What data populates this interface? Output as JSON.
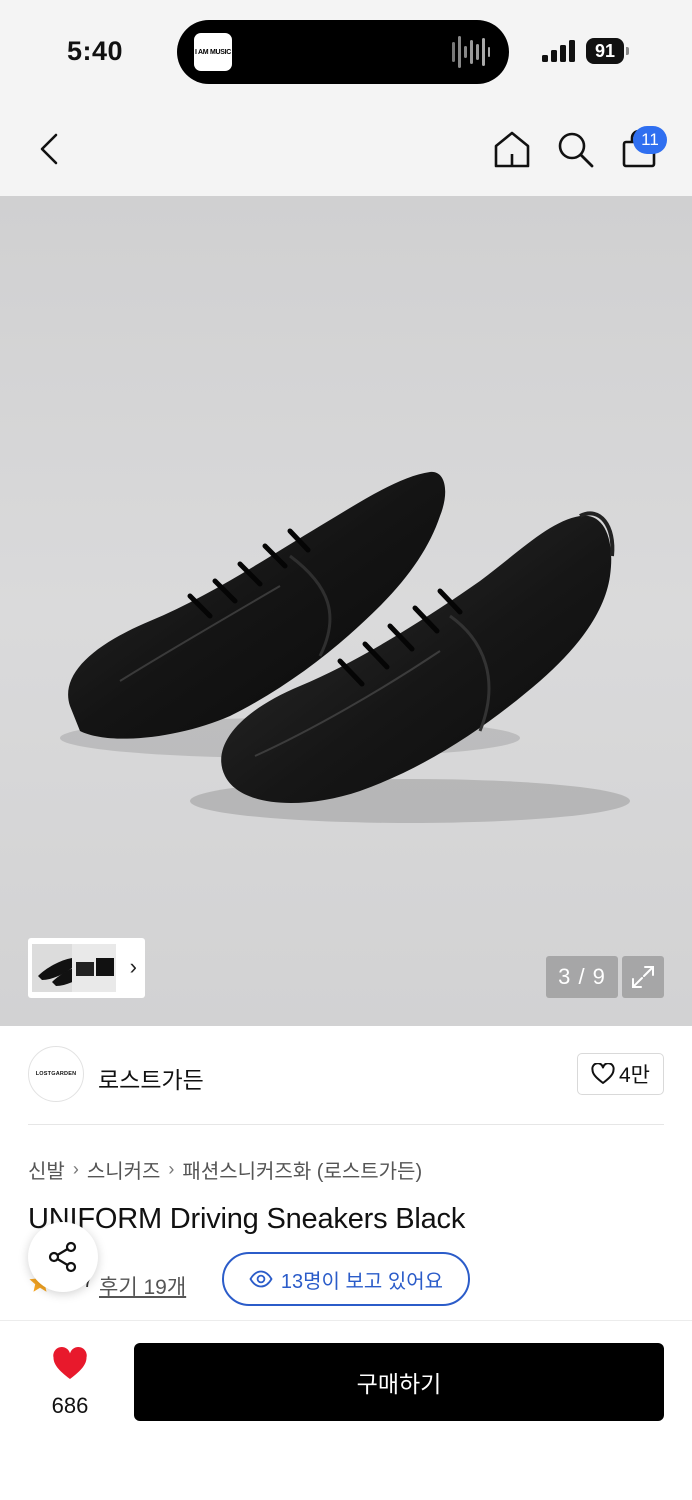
{
  "status_bar": {
    "time": "5:40",
    "battery": "91",
    "island_app_label": "I AM MUSIC"
  },
  "nav": {
    "cart_count": "11"
  },
  "gallery": {
    "counter": "3 / 9"
  },
  "brand": {
    "logo_text": "LOSTGARDEN",
    "name": "로스트가든",
    "likes": "4만"
  },
  "breadcrumb": [
    "신발",
    "스니커즈",
    "패션스니커즈화 (로스트가든)"
  ],
  "product": {
    "title": "UNIFORM Driving Sneakers Black",
    "rating": "4.7",
    "review_link": "후기 19개",
    "viewers": "13명이 보고 있어요"
  },
  "bottom_bar": {
    "wish_count": "686",
    "buy_label": "구매하기"
  },
  "colors": {
    "accent_blue": "#2b5cc9",
    "badge_blue": "#2f6ff0",
    "heart_red": "#e8192c",
    "star_orange": "#f6a623"
  }
}
